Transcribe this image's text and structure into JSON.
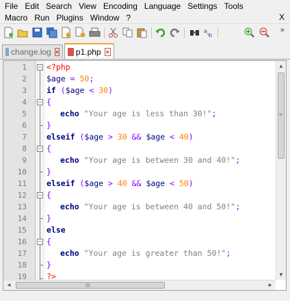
{
  "menu": {
    "row1": [
      "File",
      "Edit",
      "Search",
      "View",
      "Encoding",
      "Language",
      "Settings",
      "Tools"
    ],
    "row2": [
      "Macro",
      "Run",
      "Plugins",
      "Window",
      "?"
    ],
    "close": "X"
  },
  "toolbar": {
    "more": "»"
  },
  "tabs": [
    {
      "label": "change.log",
      "active": false
    },
    {
      "label": "p1.php",
      "active": true
    }
  ],
  "editor": {
    "line_numbers": [
      "1",
      "2",
      "3",
      "4",
      "5",
      "6",
      "7",
      "8",
      "9",
      "10",
      "11",
      "12",
      "13",
      "14",
      "15",
      "16",
      "17",
      "18",
      "19"
    ],
    "tokens": {
      "php_open": "<?php",
      "age_assign_var": "$age",
      "age_assign_eq": " = ",
      "age_value": "50",
      "semicolon": ";",
      "if_kw": "if",
      "paren_open": " (",
      "age_var": "$age",
      "lt": " < ",
      "gt": " > ",
      "and": " && ",
      "n30": "30",
      "n40": "40",
      "n50": "50",
      "paren_close": ")",
      "brace_open": "{",
      "brace_close": "}",
      "echo_kw": "echo",
      "str1": "\"Your age is less than 30!\"",
      "elseif_kw": "elseif",
      "str2": "\"Your age is between 30 and 40!\"",
      "str3": "\"Your age is between 40 and 50!\"",
      "else_kw": "else",
      "str4": "\"Your age is greater than 50!\"",
      "php_close": "?>"
    }
  },
  "scrollbars": {
    "v_up": "▲",
    "v_down": "▼",
    "v_grip": "≡",
    "h_left": "◄",
    "h_right": "►",
    "h_grip": "III"
  }
}
